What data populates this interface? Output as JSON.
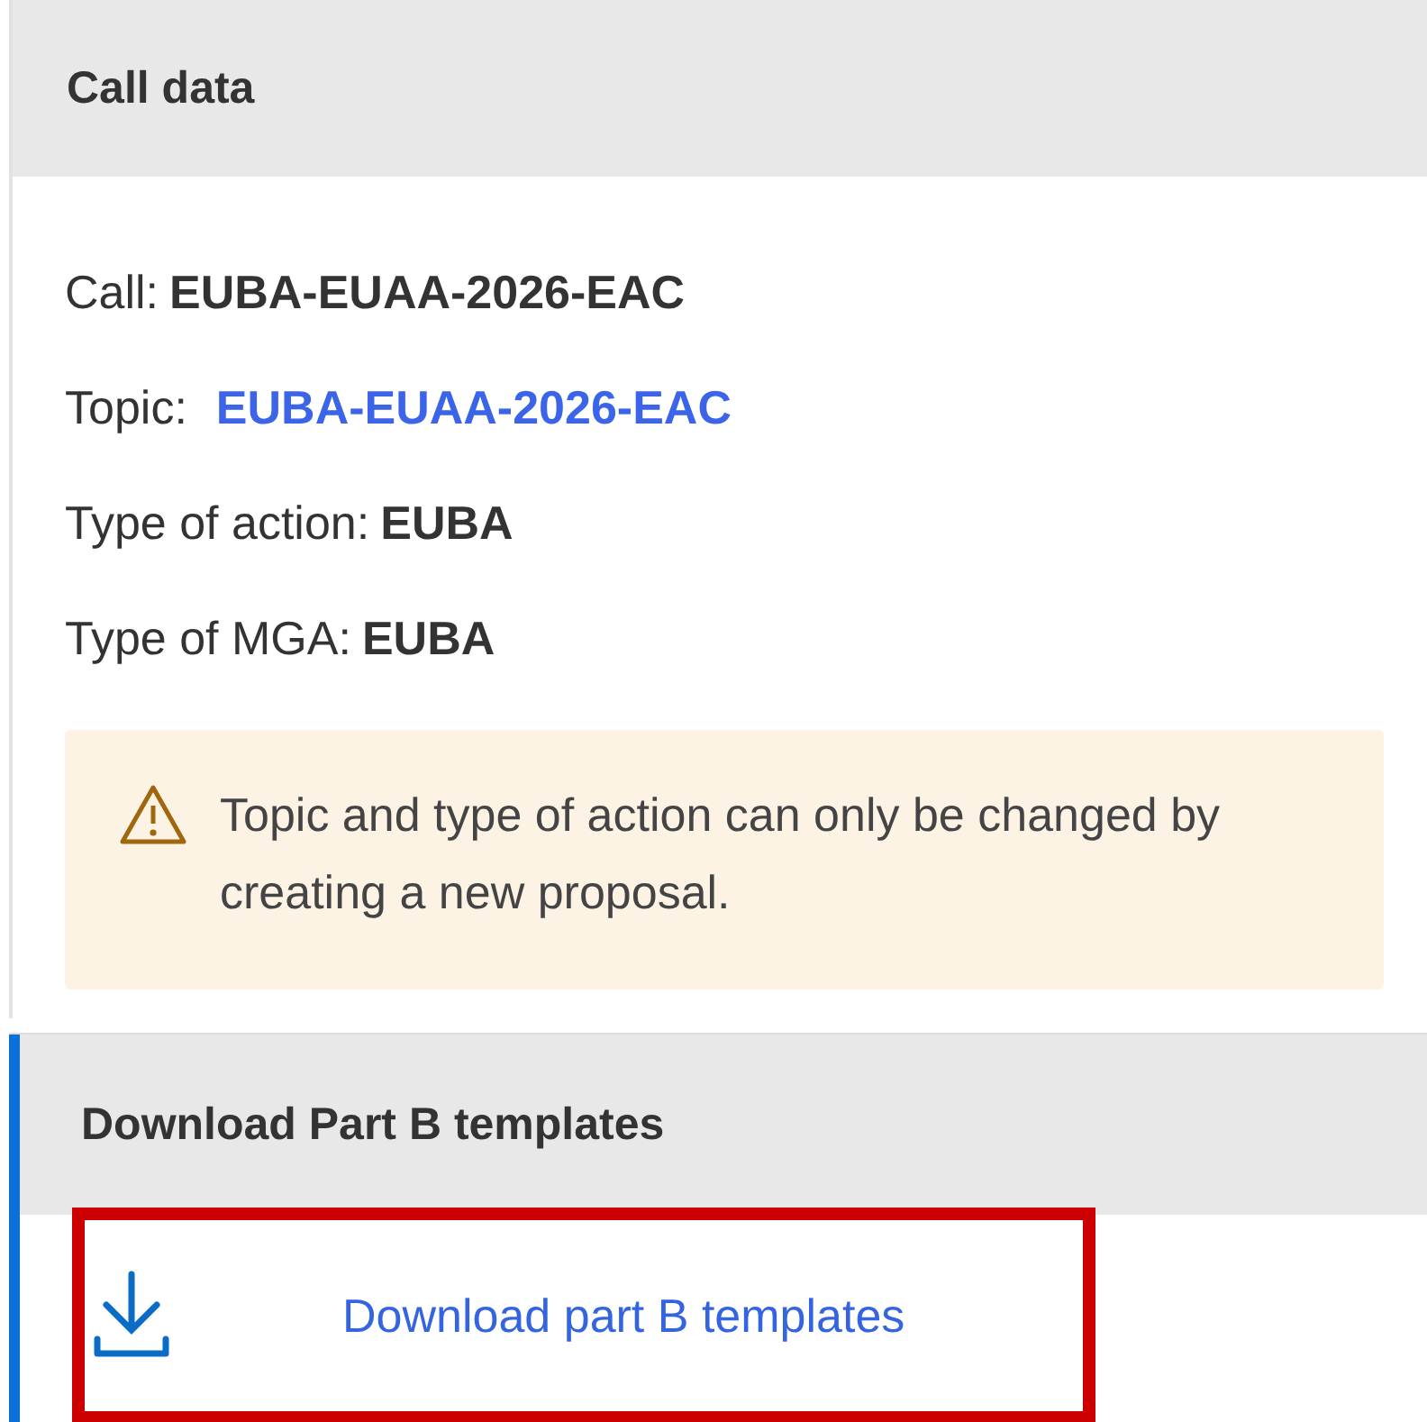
{
  "call_data": {
    "title": "Call data",
    "fields": [
      {
        "label": "Call:",
        "value": "EUBA-EUAA-2026-EAC",
        "kind": "bold"
      },
      {
        "label": "Topic:",
        "value": "EUBA-EUAA-2026-EAC",
        "kind": "link"
      },
      {
        "label": "Type of action:",
        "value": "EUBA",
        "kind": "bold"
      },
      {
        "label": "Type of MGA:",
        "value": "EUBA",
        "kind": "bold"
      }
    ],
    "notice": "Topic and type of action can only be changed by creating a new proposal."
  },
  "download": {
    "title": "Download Part B templates",
    "link": "Download part B templates",
    "highlighted": true
  }
}
